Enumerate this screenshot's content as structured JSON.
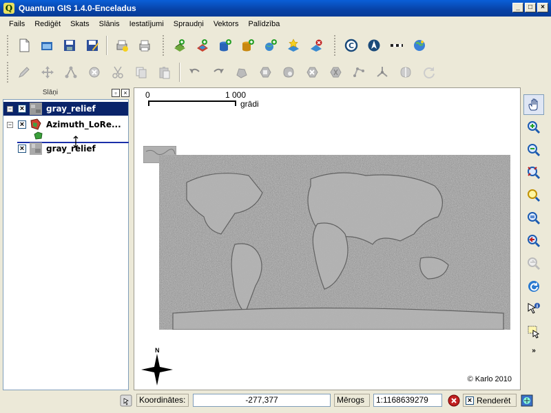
{
  "window": {
    "title": "Quantum GIS 1.4.0-Enceladus",
    "app_icon_letter": "Q"
  },
  "menu": [
    "Fails",
    "Rediģēt",
    "Skats",
    "Slānis",
    "Iestatījumi",
    "Spraudņi",
    "Vektors",
    "Palīdzība"
  ],
  "layers_panel": {
    "title": "Slāņi",
    "layers": [
      {
        "name": "gray_relief",
        "visible": true,
        "selected": true
      },
      {
        "name": "Azimuth_LoRe...",
        "visible": true,
        "selected": false
      },
      {
        "name": "gray_relief",
        "visible": true,
        "selected": false
      }
    ]
  },
  "map": {
    "scale_left": "0",
    "scale_right": "1 000",
    "scale_unit": "grādi",
    "copyright": "© Karlo 2010",
    "north_label": "N"
  },
  "status": {
    "coordinates_label": "Koordinātes:",
    "coordinates_value": "-277,377",
    "scale_label": "Mērogs",
    "scale_value": "1:1168639279",
    "render_label": "Renderēt"
  },
  "colors": {
    "titlebar": "#0a5fd8",
    "selection": "#0a246a",
    "chrome": "#ece9d8"
  }
}
